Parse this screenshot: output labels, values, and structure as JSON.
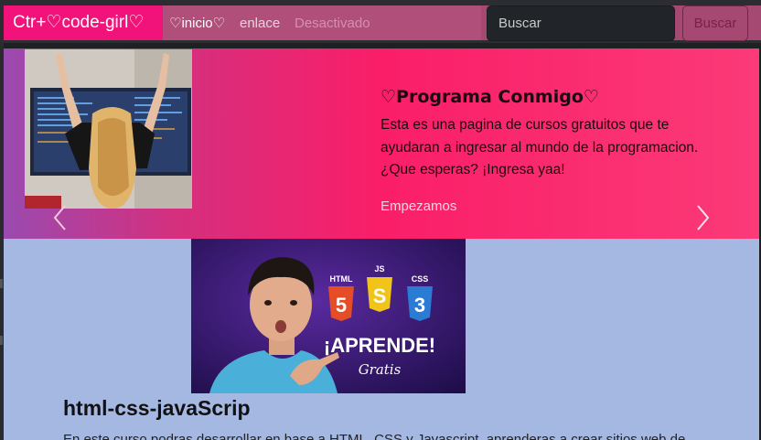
{
  "navbar": {
    "brand": "Ctr+♡code-girl♡",
    "links": [
      {
        "label": "♡inicio♡",
        "state": "active"
      },
      {
        "label": "enlace",
        "state": "normal"
      },
      {
        "label": "Desactivado",
        "state": "disabled"
      }
    ],
    "search": {
      "placeholder": "Buscar",
      "button_label": "Buscar"
    }
  },
  "carousel": {
    "title": "♡Programa Conmigo♡",
    "text": "Esta es una pagina de cursos gratuitos que te ayudaran a ingresar al mundo de la programacion. ¿Que esperas? ¡Ingresa yaa!",
    "link_label": "Empezamos"
  },
  "card": {
    "thumbnail": {
      "badges": [
        "HTML",
        "JS",
        "CSS"
      ],
      "headline": "¡APRENDE!",
      "tagline": "Gratis"
    },
    "title": "html-css-javaScrip",
    "text": "En este curso podras desarrollar en base a HTML, CSS y Javascript, aprenderas a crear sitios web de..."
  },
  "colors": {
    "brand_bg": "#f2137a",
    "carousel_start": "#9a4ab0",
    "carousel_end": "#fb3a78",
    "content_bg": "#a4b8e2"
  }
}
